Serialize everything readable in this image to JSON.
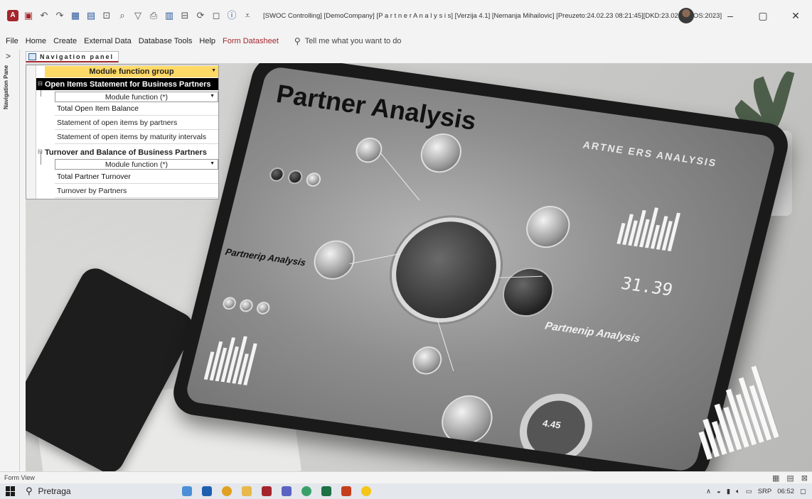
{
  "window": {
    "title": "[SWOC Controlling] [DemoCompany] [P a r t n e r   A n a l y s i s] [Verzija 4.1] [Nemanja Mihailovic] [Preuzeto:24.02.23 08:21:45][DKD:23.02.23][IOS:2023]",
    "controls": {
      "minimize": "–",
      "restore": "▢",
      "close": "✕"
    }
  },
  "qat_icons": [
    "access-logo-icon",
    "save-icon",
    "undo-icon",
    "redo-icon",
    "form-view-icon",
    "datasheet-icon",
    "filter-icon",
    "search-icon",
    "sort-icon",
    "print-icon",
    "table-icon",
    "design-icon",
    "refresh-icon",
    "close-form-icon",
    "info-icon",
    "customize-icon"
  ],
  "ribbon": {
    "tabs": [
      "File",
      "Home",
      "Create",
      "External Data",
      "Database Tools",
      "Help"
    ],
    "contextual_tab": "Form Datasheet",
    "tell_me": "Tell me what you want to do"
  },
  "nav_strip": {
    "label": "Navigation Pane",
    "chevron": ">"
  },
  "document_tab": {
    "label": "Navigation panel"
  },
  "nav_panel": {
    "header": "Module function group",
    "groups": [
      {
        "title": "Open Items Statement for Business Partners",
        "active": true,
        "subheader": "Module function (*)",
        "items": [
          "Total Open Item Balance",
          "Statement of open items by partners",
          "Statement of open items by maturity intervals"
        ]
      },
      {
        "title": "Turnover and Balance of Business Partners",
        "active": false,
        "subheader": "Module function (*)",
        "items": [
          "Total Partner Turnover",
          "Turnover by Partners"
        ]
      }
    ]
  },
  "background_image": {
    "headline": "Partner Analysis",
    "subtitle_left": "Partnerip Analysis",
    "subtitle_right": "Partnenip Analysis",
    "small_caps": "ARTNE ERS ANALYSIS",
    "counter": "31.39",
    "gauge_value": "4.45"
  },
  "status_bar": {
    "label": "Form View"
  },
  "taskbar": {
    "search_placeholder": "Pretraga",
    "language": "SRP",
    "time": "06:52"
  },
  "colors": {
    "access_red": "#a4262c",
    "group_header": "#ffd966",
    "active_group_bg": "#000000"
  }
}
